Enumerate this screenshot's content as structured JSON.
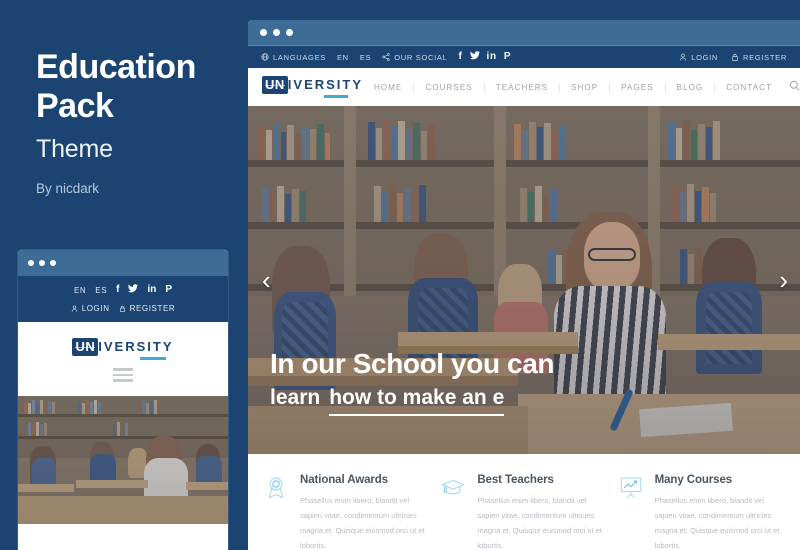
{
  "promo": {
    "title_line1": "Education",
    "title_line2": "Pack",
    "subtitle": "Theme",
    "byline": "By nicdark"
  },
  "colors": {
    "background": "#1b4472",
    "brand_navy": "#1b4472",
    "chrome_blue": "#3d6c96",
    "accent_cyan": "#3fa9d8",
    "feature_icon": "#6fc4e8",
    "nav_text": "#9aa3ab"
  },
  "browser": {
    "window_dots": 3,
    "topbar": {
      "languages_label": "LANGUAGES",
      "languages_icon": "globe-icon",
      "lang_en": "EN",
      "lang_es": "ES",
      "social_label": "OUR SOCIAL",
      "social_icon": "share-icon",
      "socials": [
        {
          "name": "facebook-icon",
          "glyph": "f"
        },
        {
          "name": "twitter-icon",
          "glyph": "✈"
        },
        {
          "name": "linkedin-icon",
          "glyph": "in"
        },
        {
          "name": "pinterest-icon",
          "glyph": "P"
        }
      ],
      "login_label": "LOGIN",
      "login_icon": "user-icon",
      "register_label": "REGISTER",
      "register_icon": "lock-icon"
    },
    "logo": {
      "mark": "UN",
      "rest": "IVERSITY"
    },
    "nav": [
      {
        "label": "HOME"
      },
      {
        "label": "COURSES"
      },
      {
        "label": "TEACHERS"
      },
      {
        "label": "SHOP"
      },
      {
        "label": "PAGES"
      },
      {
        "label": "BLOG"
      },
      {
        "label": "CONTACT"
      }
    ],
    "search_icon": "search-icon",
    "hero": {
      "line1": "In our School you can",
      "line2_plain": "learn",
      "line2_underlined": "how to make an e",
      "prev_arrow": "‹",
      "next_arrow": "›"
    },
    "features": [
      {
        "icon": "award-ribbon-icon",
        "title": "National Awards",
        "text": "Phasellus enim libero, blandit vel sapien vitae, condimentum ultricies magna et. Quisque euismod orci ut et lobortis."
      },
      {
        "icon": "graduation-cap-icon",
        "title": "Best Teachers",
        "text": "Phasellus enim libero, blandit vel sapien vitae, condimentum ultricies magna et. Quisque euismod orci ut et lobortis."
      },
      {
        "icon": "chart-board-icon",
        "title": "Many Courses",
        "text": "Phasellus enim libero, blandit vel sapien vitae, condimentum ultricies magna et. Quisque euismod orci ut et lobortis."
      }
    ]
  },
  "mobile": {
    "window_dots": 3,
    "lang_en": "EN",
    "lang_es": "ES",
    "socials": [
      {
        "name": "facebook-icon",
        "glyph": "f"
      },
      {
        "name": "twitter-icon",
        "glyph": "✈"
      },
      {
        "name": "linkedin-icon",
        "glyph": "in"
      },
      {
        "name": "pinterest-icon",
        "glyph": "P"
      }
    ],
    "login_label": "LOGIN",
    "register_label": "REGISTER",
    "logo": {
      "mark": "UN",
      "rest": "IVERSITY"
    },
    "menu_icon": "hamburger-menu-icon"
  }
}
